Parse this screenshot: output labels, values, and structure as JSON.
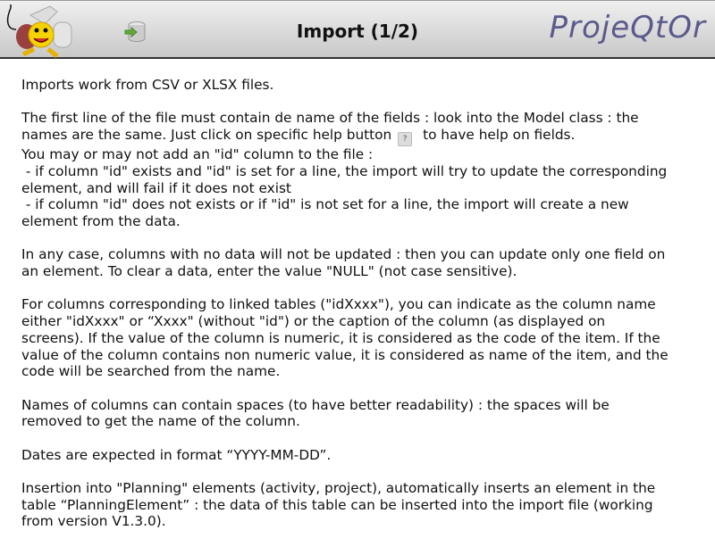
{
  "header": {
    "title": "Import (1/2)",
    "brand": "ProjeQtOr"
  },
  "paragraphs": [
    [
      "Imports work from CSV or XLSX files."
    ],
    [
      "The first line of the file must contain de name of the fields : look into the Model class : the",
      "names are the same. Just click on specific help button",
      "to have help on fields.",
      "You may or may not add an \"id\" column to the file :",
      " - if column \"id\" exists and \"id\" is set for a line, the import will try to update the corresponding",
      "element, and will fail if it does not exist",
      " - if column \"id\" does not exists or if \"id\" is not set for a line, the import will create a new",
      "element from the data."
    ],
    [
      "In any case, columns with no data will not be updated : then you can update only one field on",
      "an element. To clear a data, enter the value \"NULL\" (not case sensitive)."
    ],
    [
      "For columns corresponding to linked tables (\"idXxxx\"), you can indicate as the column name",
      "either \"idXxxx\" or “Xxxx\" (without \"id\") or the caption of the column (as displayed on",
      "screens). If the value of the column is numeric, it is considered as the code of the item. If the",
      "value of the column contains non numeric value, it is considered as name of the item, and the",
      "code will be searched from the name."
    ],
    [
      "Names of columns can contain spaces (to have better readability) : the spaces will be",
      "removed to get the name of the column."
    ],
    [
      "Dates are expected in format “YYYY-MM-DD”."
    ],
    [
      "Insertion into \"Planning\" elements (activity, project), automatically inserts an element in the",
      "table “PlanningElement” : the data of this table can be inserted into the import file (working",
      "from version V1.3.0)."
    ]
  ]
}
